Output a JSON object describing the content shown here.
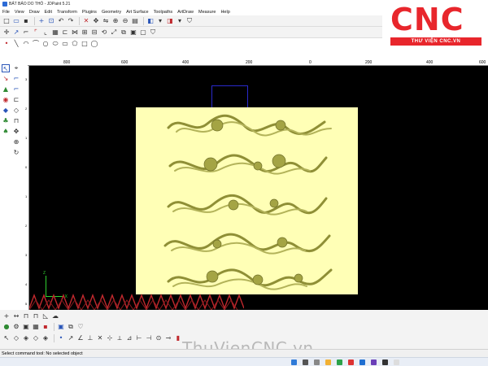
{
  "window": {
    "title": "BẢT BẢO DO THỎ - JDPaint 5.21"
  },
  "menu": [
    "File",
    "View",
    "Draw",
    "Edit",
    "Transform",
    "Plugins",
    "Geometry",
    "Art Surface",
    "Toolpaths",
    "ArtDraw",
    "Measure",
    "Help"
  ],
  "logo": {
    "brand": "CNC",
    "subtitle": "THƯ VIỆN CNC.VN",
    "color": "#e8262c"
  },
  "ruler": {
    "top_ticks": [
      "800",
      "600",
      "400",
      "200",
      "0",
      "200",
      "400",
      "600"
    ],
    "left_ticks": [
      "3",
      "2",
      "1",
      "0",
      "1",
      "2",
      "3",
      "4",
      "5"
    ]
  },
  "viewport": {
    "background": "#000000",
    "model_color": "#ffffb6",
    "relief_color": "#9a9a3a",
    "axis_labels": {
      "z": "Z",
      "x": "X"
    }
  },
  "icons": {
    "toolbar1": [
      "new-file-icon",
      "open-file-icon",
      "save-icon",
      "add-icon",
      "select-window-icon",
      "undo-icon",
      "redo-icon",
      "delete-icon",
      "move-icon",
      "mirror-icon",
      "zoom-in-icon",
      "zoom-out-icon",
      "print-icon",
      "shade-icon",
      "view-icon",
      "shield-icon"
    ],
    "toolbar2": [
      "node-edit-icon",
      "trim-icon",
      "cut-icon",
      "corner-icon",
      "fillet-icon",
      "align-icon",
      "join-icon",
      "break-icon",
      "offset-icon",
      "array-icon",
      "rotate-icon",
      "scale-icon",
      "copy-icon",
      "group-icon",
      "ungroup-icon",
      "shield-icon"
    ],
    "toolbar3": [
      "point-icon",
      "line-icon",
      "arc-icon",
      "polyline-icon",
      "circle-icon",
      "ellipse-icon",
      "rectangle-icon",
      "polygon-icon",
      "text-icon",
      "spline-icon"
    ],
    "left": [
      "select-arrow-icon",
      "select-icon",
      "arrow-icon",
      "ruler-icon",
      "zoom-icon",
      "cut-icon",
      "color-icon",
      "fill-icon",
      "palette-icon",
      "layer-icon",
      "move-icon",
      "zoom-icon",
      "refresh-icon",
      "node-icon"
    ],
    "bottom1": [
      "add-icon",
      "level-icon",
      "measure-icon",
      "snap-icon",
      "mirror-icon",
      "cloud-icon"
    ],
    "bottom2": [
      "bulb-icon",
      "settings-icon",
      "display-icon",
      "grid-icon",
      "color-icon",
      "layer-icon",
      "copy-icon",
      "heart-icon"
    ],
    "bottom3": [
      "arrow-icon",
      "snap-icon",
      "grid-icon",
      "point-icon",
      "midpoint-icon",
      "center-icon",
      "end-icon",
      "angle-icon",
      "tangent-icon",
      "intersection-icon",
      "cross-icon",
      "perpendicular-icon",
      "near-icon",
      "axis-icon",
      "distance-icon",
      "polar-icon",
      "extend-icon",
      "lock-icon"
    ]
  },
  "watermark": "ThuVienCNC.vn",
  "status": {
    "text": "Select command tool: No selected object"
  }
}
